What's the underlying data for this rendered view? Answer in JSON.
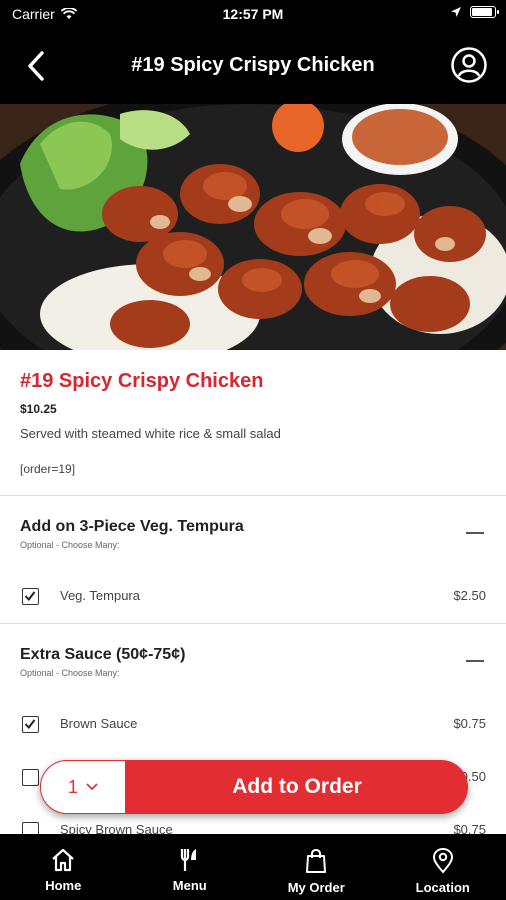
{
  "status_bar": {
    "carrier": "Carrier",
    "time": "12:57 PM",
    "battery_level": 0.95
  },
  "header": {
    "title": "#19 Spicy Crispy Chicken",
    "back_icon": "chevron-left-icon",
    "account_icon": "user-circle-icon"
  },
  "item": {
    "name": "#19 Spicy Crispy Chicken",
    "price": "$10.25",
    "description": "Served with steamed white rice & small salad",
    "tag": "[order=19]"
  },
  "groups": [
    {
      "title": "Add on 3-Piece Veg. Tempura",
      "subtitle": "Optional - Choose Many:",
      "options": [
        {
          "label": "Veg. Tempura",
          "price": "$2.50",
          "checked": true
        }
      ]
    },
    {
      "title": "Extra Sauce (50¢-75¢)",
      "subtitle": "Optional - Choose Many:",
      "options": [
        {
          "label": "Brown Sauce",
          "price": "$0.75",
          "checked": true
        },
        {
          "label": "",
          "price": "$0.50",
          "checked": false
        },
        {
          "label": "Spicy Brown Sauce",
          "price": "$0.75",
          "checked": false
        }
      ]
    }
  ],
  "order_bar": {
    "quantity": "1",
    "add_label": "Add to Order"
  },
  "tabs": [
    {
      "label": "Home",
      "icon": "home-icon"
    },
    {
      "label": "Menu",
      "icon": "utensils-icon"
    },
    {
      "label": "My Order",
      "icon": "shopping-bag-icon"
    },
    {
      "label": "Location",
      "icon": "map-pin-icon"
    }
  ],
  "colors": {
    "accent": "#e22d33",
    "title_red": "#d9262e",
    "bar_black": "#000000"
  }
}
